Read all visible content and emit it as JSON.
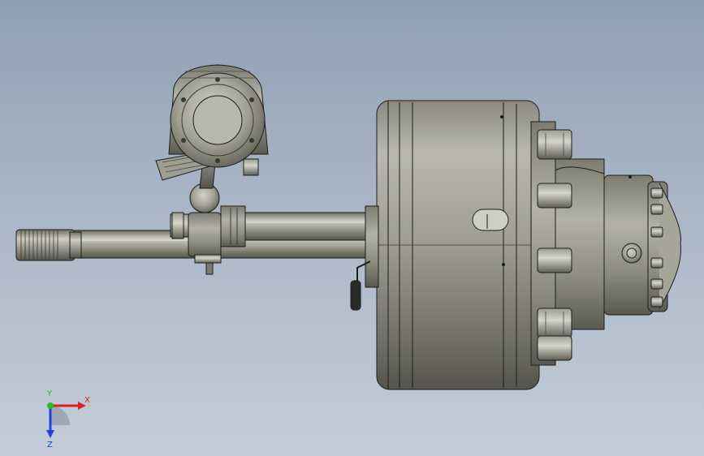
{
  "viewport": {
    "background_top": "#8f9fb3",
    "background_bottom": "#c3cdd9"
  },
  "model": {
    "body_color": "#8e8d80",
    "body_light": "#c9c8bc",
    "body_dark": "#4d4c44",
    "edge_color": "#1d1d1b"
  },
  "triad": {
    "x_label": "X",
    "y_label": "Y",
    "z_label": "Z",
    "x_color": "#e02020",
    "y_color": "#20c020",
    "z_color": "#2040e0"
  }
}
